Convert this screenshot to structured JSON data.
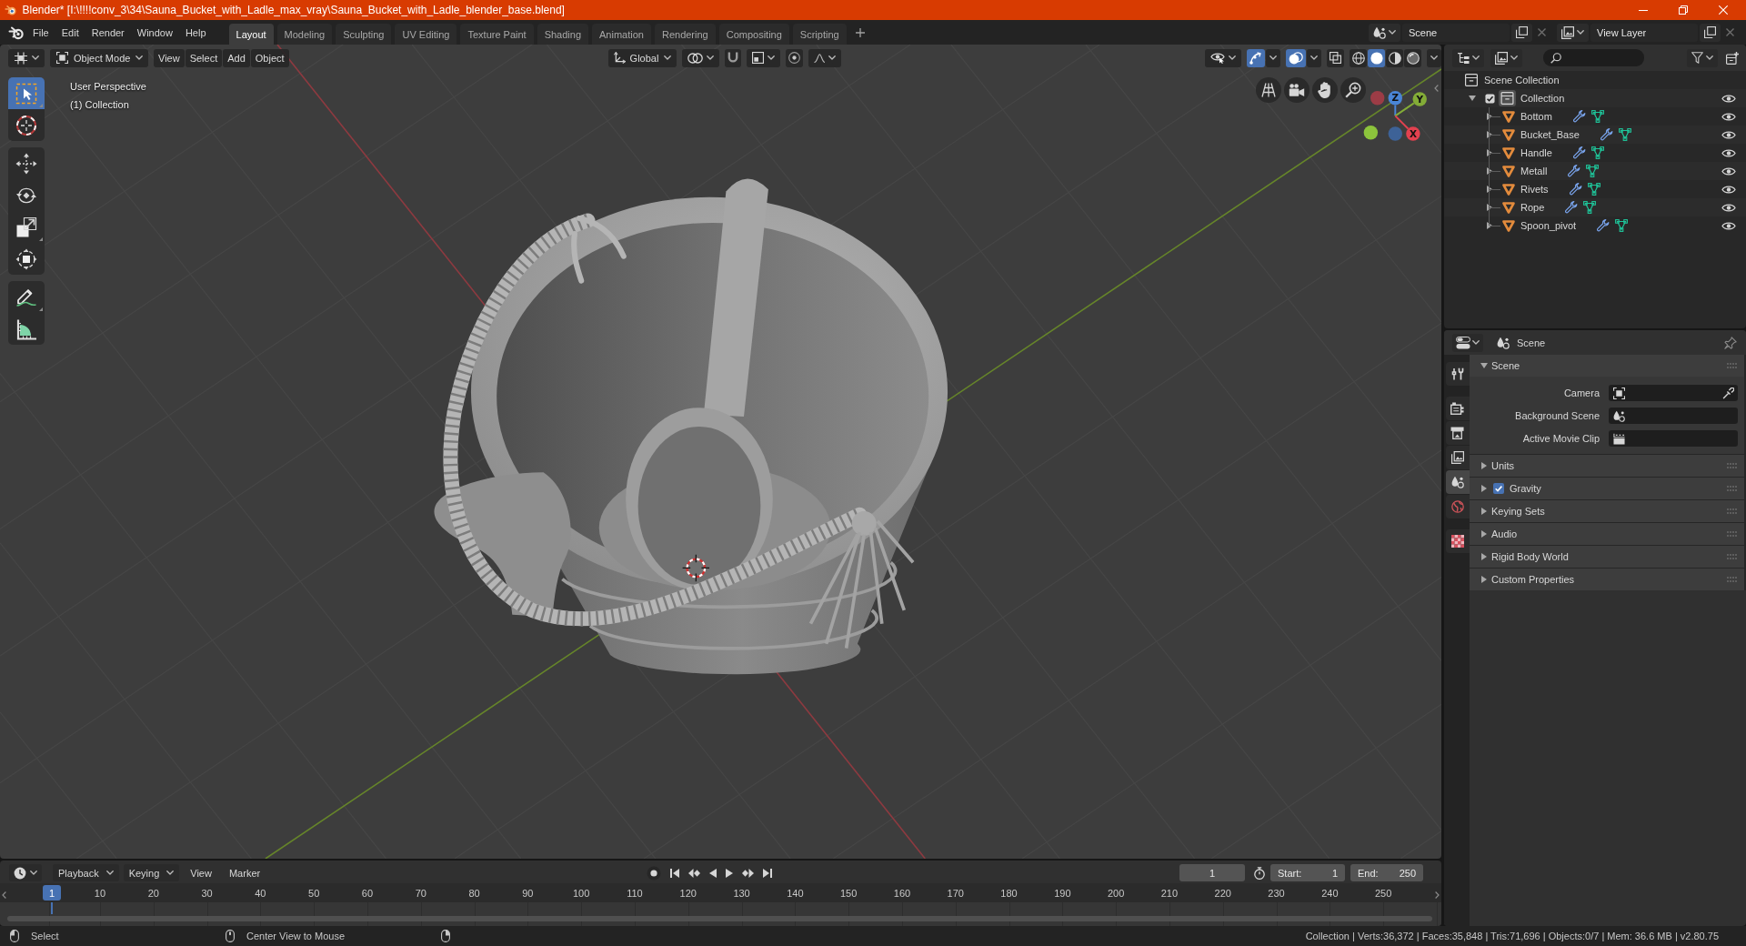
{
  "window": {
    "title": "Blender* [I:\\!!!!conv_3\\34\\Sauna_Bucket_with_Ladle_max_vray\\Sauna_Bucket_with_Ladle_blender_base.blend]"
  },
  "top_bar": {
    "menus": [
      "File",
      "Edit",
      "Render",
      "Window",
      "Help"
    ],
    "workspaces": [
      {
        "label": "Layout",
        "selected": true
      },
      {
        "label": "Modeling",
        "selected": false
      },
      {
        "label": "Sculpting",
        "selected": false
      },
      {
        "label": "UV Editing",
        "selected": false
      },
      {
        "label": "Texture Paint",
        "selected": false
      },
      {
        "label": "Shading",
        "selected": false
      },
      {
        "label": "Animation",
        "selected": false
      },
      {
        "label": "Rendering",
        "selected": false
      },
      {
        "label": "Compositing",
        "selected": false
      },
      {
        "label": "Scripting",
        "selected": false
      }
    ],
    "scene": "Scene",
    "view_layer": "View Layer"
  },
  "viewport": {
    "mode": "Object Mode",
    "menus": [
      "View",
      "Select",
      "Add",
      "Object"
    ],
    "orientation": "Global",
    "snapping": false,
    "proportional_editing": false,
    "gizmos": true,
    "overlays": true,
    "xray": false,
    "shading": [
      {
        "kind": "wireframe",
        "selected": false
      },
      {
        "kind": "solid",
        "selected": true
      },
      {
        "kind": "material",
        "selected": false
      },
      {
        "kind": "rendered",
        "selected": false
      }
    ],
    "overlay_text": [
      "User Perspective",
      "(1) Collection"
    ],
    "toolbar": [
      [
        {
          "kind": "select-box",
          "selected": true
        },
        {
          "kind": "cursor",
          "selected": false
        }
      ],
      [
        {
          "kind": "move",
          "selected": false
        },
        {
          "kind": "rotate",
          "selected": false
        },
        {
          "kind": "scale",
          "selected": false
        },
        {
          "kind": "transform",
          "selected": false
        }
      ],
      [
        {
          "kind": "annotate",
          "selected": false
        },
        {
          "kind": "measure",
          "selected": false
        }
      ]
    ],
    "gizmo_axes": [
      {
        "kind": "z",
        "label": "Z"
      },
      {
        "kind": "y",
        "label": "Y"
      },
      {
        "kind": "x",
        "label": "X"
      }
    ]
  },
  "outliner": {
    "root": "Scene Collection",
    "collections": [
      {
        "label": "Collection",
        "checked": true,
        "active": true,
        "expanded": true,
        "children": [
          {
            "label": "Bottom",
            "expanded": false
          },
          {
            "label": "Bucket_Base",
            "expanded": false
          },
          {
            "label": "Handle",
            "expanded": false
          },
          {
            "label": "Metall",
            "expanded": false
          },
          {
            "label": "Rivets",
            "expanded": false
          },
          {
            "label": "Rope",
            "expanded": false
          },
          {
            "label": "Spoon_pivot",
            "expanded": false
          }
        ]
      }
    ]
  },
  "properties": {
    "context": "Scene",
    "tabs": [
      [
        {
          "kind": "tool",
          "selected": false
        }
      ],
      [
        {
          "kind": "render",
          "selected": false
        },
        {
          "kind": "output",
          "selected": false
        },
        {
          "kind": "view-layer",
          "selected": false
        },
        {
          "kind": "scene",
          "selected": true
        },
        {
          "kind": "world",
          "selected": false
        }
      ],
      [
        {
          "kind": "texture",
          "selected": false
        }
      ]
    ],
    "panels": [
      {
        "kind": "plain",
        "title": "Scene",
        "expanded": true,
        "fields": [
          {
            "kind": "camera",
            "label": "Camera"
          },
          {
            "kind": "scene",
            "label": "Background Scene"
          },
          {
            "kind": "clip",
            "label": "Active Movie Clip"
          }
        ]
      },
      {
        "kind": "plain",
        "title": "Units",
        "expanded": false
      },
      {
        "kind": "toggle",
        "title": "Gravity",
        "checked": true,
        "expanded": false
      },
      {
        "kind": "plain",
        "title": "Keying Sets",
        "expanded": false
      },
      {
        "kind": "plain",
        "title": "Audio",
        "expanded": false
      },
      {
        "kind": "plain",
        "title": "Rigid Body World",
        "expanded": false
      },
      {
        "kind": "plain",
        "title": "Custom Properties",
        "expanded": false
      }
    ]
  },
  "timeline": {
    "menus": [
      {
        "kind": "dropdown",
        "label": "Playback"
      },
      {
        "kind": "dropdown",
        "label": "Keying"
      },
      {
        "kind": "menu",
        "label": "View"
      },
      {
        "kind": "menu",
        "label": "Marker"
      }
    ],
    "frame": "1",
    "start": {
      "label": "Start:",
      "value": "1"
    },
    "end": {
      "label": "End:",
      "value": "250"
    },
    "ruler": {
      "current": "1",
      "ticks": [
        "10",
        "20",
        "30",
        "40",
        "50",
        "60",
        "70",
        "80",
        "90",
        "100",
        "110",
        "120",
        "130",
        "140",
        "150",
        "160",
        "170",
        "180",
        "190",
        "200",
        "210",
        "220",
        "230",
        "240",
        "250"
      ]
    }
  },
  "status_bar": {
    "hints": [
      {
        "kind": "left-click",
        "label": "Select"
      },
      {
        "kind": "middle-click",
        "label": "Center View to Mouse"
      },
      {
        "kind": "right-click"
      }
    ],
    "stats": "Collection | Verts:36,372 | Faces:35,848 | Tris:71,696 | Objects:0/7 | Mem: 36.6 MB | v2.80.75"
  }
}
